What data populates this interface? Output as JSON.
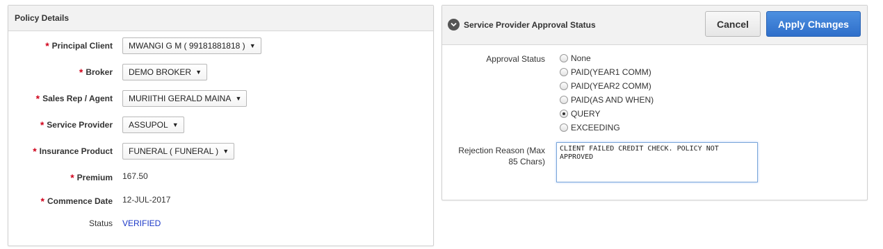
{
  "policy": {
    "title": "Policy Details",
    "fields": [
      {
        "label": "Principal Client",
        "required": true,
        "value": "MWANGI G M ( 99181881818 )"
      },
      {
        "label": "Broker",
        "required": true,
        "value": "DEMO BROKER"
      },
      {
        "label": "Sales Rep / Agent",
        "required": true,
        "value": "MURIITHI GERALD MAINA"
      },
      {
        "label": "Service Provider",
        "required": true,
        "value": "ASSUPOL"
      },
      {
        "label": "Insurance Product",
        "required": true,
        "value": "FUNERAL ( FUNERAL )"
      },
      {
        "label": "Premium",
        "required": true,
        "value": "167.50"
      },
      {
        "label": "Commence Date",
        "required": true,
        "value": "12-JUL-2017"
      },
      {
        "label": "Status",
        "required": false,
        "value": "VERIFIED"
      }
    ],
    "required_marker": "*",
    "dropdown_caret": "▼",
    "status_color": "#1a37c7"
  },
  "approval": {
    "title": "Service Provider Approval Status",
    "cancel_label": "Cancel",
    "apply_label": "Apply Changes",
    "status_label": "Approval Status",
    "options": [
      {
        "label": "None",
        "checked": false
      },
      {
        "label": "PAID(YEAR1 COMM)",
        "checked": false
      },
      {
        "label": "PAID(YEAR2 COMM)",
        "checked": false
      },
      {
        "label": "PAID(AS AND WHEN)",
        "checked": false
      },
      {
        "label": "QUERY",
        "checked": true
      },
      {
        "label": "EXCEEDING",
        "checked": false
      }
    ],
    "reason_label_line1": "Rejection Reason (Max",
    "reason_label_line2": "85 Chars)",
    "reason_value": "CLIENT FAILED CREDIT CHECK. POLICY NOT APPROVED",
    "apply_color": "#2f6fca"
  }
}
